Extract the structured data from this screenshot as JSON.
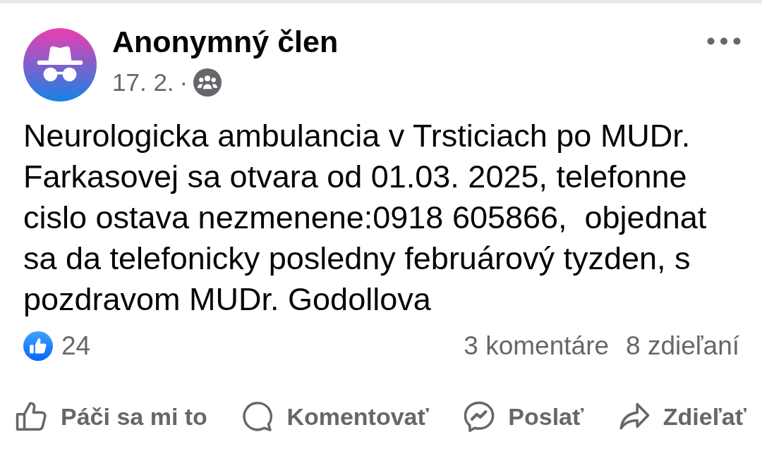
{
  "post": {
    "author": "Anonymný člen",
    "date": "17. 2.",
    "separator": "·",
    "text": "Neurologicka ambulancia v Trsticiach po MUDr. Farkasovej sa otvara od 01.03. 2025, telefonne cislo ostava nezmenene:0918 605866,  objednat sa da telefonicky posledny februárový tyzden, s pozdravom MUDr. Godollova"
  },
  "stats": {
    "likes": "24",
    "comments": "3 komentáre",
    "shares": "8 zdieľaní"
  },
  "actions": [
    {
      "kind": "like",
      "label": "Páči sa mi to"
    },
    {
      "kind": "comment",
      "label": "Komentovať"
    },
    {
      "kind": "send",
      "label": "Poslať"
    },
    {
      "kind": "share",
      "label": "Zdieľať"
    }
  ]
}
